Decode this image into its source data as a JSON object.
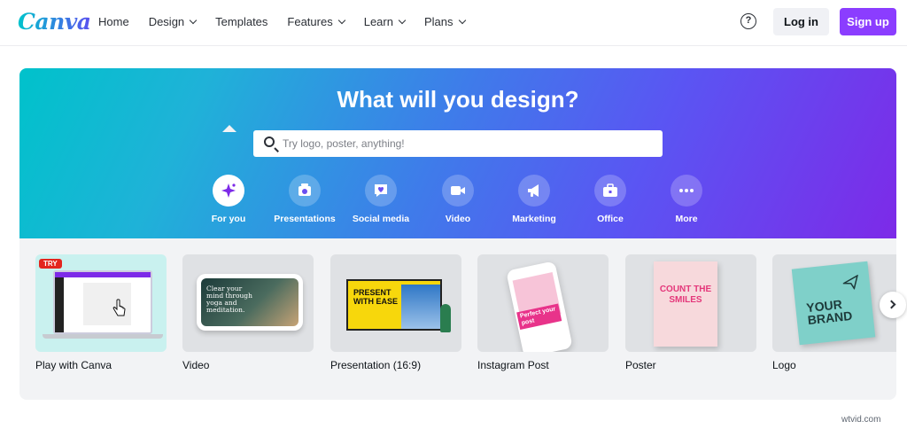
{
  "header": {
    "logo": "Canva",
    "nav": [
      {
        "label": "Home",
        "dropdown": false
      },
      {
        "label": "Design",
        "dropdown": true
      },
      {
        "label": "Templates",
        "dropdown": false
      },
      {
        "label": "Features",
        "dropdown": true
      },
      {
        "label": "Learn",
        "dropdown": true
      },
      {
        "label": "Plans",
        "dropdown": true
      }
    ],
    "help_symbol": "?",
    "login_label": "Log in",
    "signup_label": "Sign up"
  },
  "hero": {
    "title": "What will you design?",
    "search_placeholder": "Try logo, poster, anything!",
    "categories": [
      {
        "label": "For you",
        "icon": "sparkle-icon",
        "active": true
      },
      {
        "label": "Presentations",
        "icon": "presentation-icon",
        "active": false
      },
      {
        "label": "Social media",
        "icon": "heart-chat-icon",
        "active": false
      },
      {
        "label": "Video",
        "icon": "video-camera-icon",
        "active": false
      },
      {
        "label": "Marketing",
        "icon": "megaphone-icon",
        "active": false
      },
      {
        "label": "Office",
        "icon": "briefcase-icon",
        "active": false
      },
      {
        "label": "More",
        "icon": "more-dots-icon",
        "active": false
      }
    ]
  },
  "cards": {
    "items": [
      {
        "label": "Play with Canva",
        "badge": "TRY"
      },
      {
        "label": "Video",
        "thumb_text": "Clear your mind through yoga and meditation."
      },
      {
        "label": "Presentation (16:9)",
        "thumb_text": "PRESENT WITH EASE"
      },
      {
        "label": "Instagram Post",
        "thumb_text": "Perfect your post"
      },
      {
        "label": "Poster",
        "thumb_text": "COUNT THE SMILES"
      },
      {
        "label": "Logo",
        "thumb_text": "YOUR BRAND"
      }
    ]
  },
  "watermark": "wtvid.com",
  "colors": {
    "brand_purple": "#8b3dff",
    "hero_gradient_start": "#00c2cb",
    "hero_gradient_end": "#7d2ae8"
  }
}
